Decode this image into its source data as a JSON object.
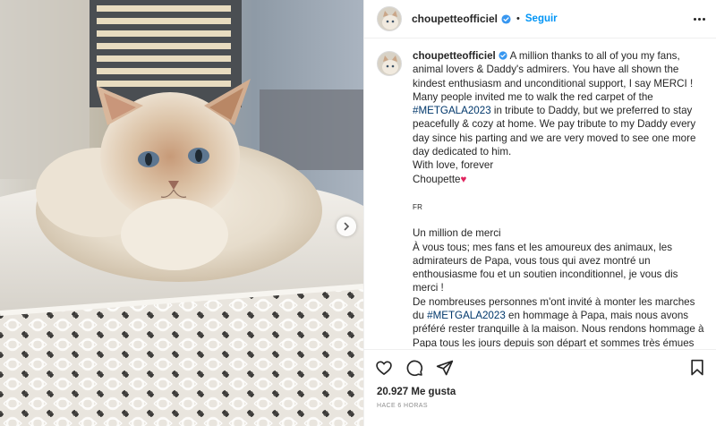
{
  "post": {
    "image_alt": "Choupette cat sitting on a lace tablecloth"
  },
  "header": {
    "username": "choupetteofficiel",
    "separator": "•",
    "follow_label": "Seguir"
  },
  "caption": {
    "username": "choupetteofficiel",
    "en_1": " A million thanks to all of you my fans, animal lovers & Daddy's admirers. You have all shown the kindest enthusiasm and unconditional support, I say MERCI ! Many people invited me to walk the red carpet of the ",
    "tag_1": "#METGALA2023",
    "en_2": " in tribute to Daddy, but we preferred to stay peacefully & cozy at home. We pay tribute to my Daddy every day since his parting and we are very moved to see one more day dedicated to him.",
    "en_3": "With love, forever",
    "en_4": "Choupette",
    "heart": "♥",
    "fr_marker": "FR",
    "fr_1": "Un million de merci",
    "fr_2": "À vous tous; mes fans et les amoureux des animaux, les admirateurs de Papa, vous tous qui avez montré un enthousiasme fou et un soutien inconditionnel, je vous dis merci !",
    "fr_3": "De nombreuses personnes m'ont invité à monter les marches du ",
    "tag_2": "#METGALA2023",
    "fr_4": " en hommage à Papa, mais nous avons préféré rester tranquille à la maison. Nous rendons hommage à Papa tous les jours depuis son départ et sommes très émues de voir une journée de plus qui lui est dédiée."
  },
  "actions": {
    "likes": "20.927 Me gusta",
    "time": "HACE 6 HORAS"
  },
  "colors": {
    "accent": "#0095f6",
    "hashtag": "#00376b",
    "heart": "#e0245e"
  },
  "icons": [
    "verified-badge-icon",
    "more-options-icon",
    "like-heart-icon",
    "comment-icon",
    "share-icon",
    "bookmark-icon",
    "chevron-right-icon"
  ]
}
